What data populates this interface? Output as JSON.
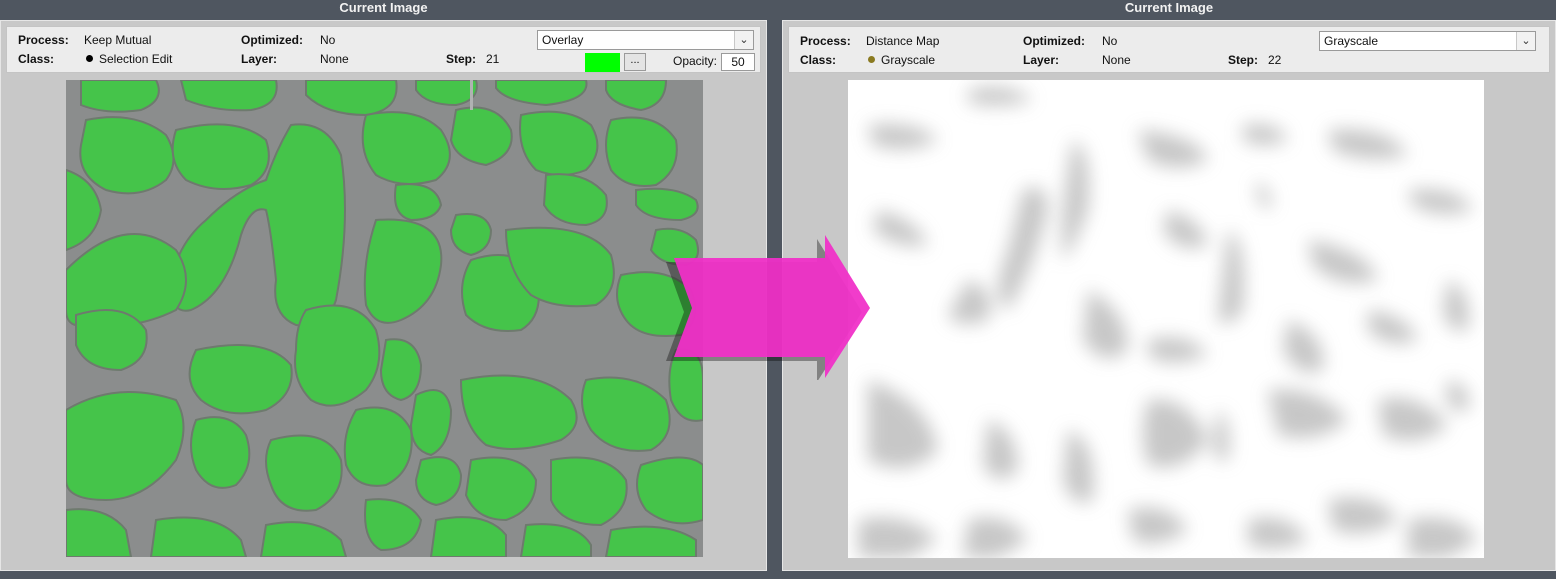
{
  "left_panel": {
    "title": "Current Image",
    "process_label": "Process:",
    "process_value": "Keep Mutual",
    "optimized_label": "Optimized:",
    "optimized_value": "No",
    "class_label": "Class:",
    "class_value": "Selection Edit",
    "class_color": "#000000",
    "layer_label": "Layer:",
    "layer_value": "None",
    "step_label": "Step:",
    "step_value": "21",
    "display_mode": "Overlay",
    "overlay_color": "#00ff00",
    "ellipsis_label": "...",
    "opacity_label": "Opacity:",
    "opacity_value": "50"
  },
  "right_panel": {
    "title": "Current Image",
    "process_label": "Process:",
    "process_value": "Distance Map",
    "optimized_label": "Optimized:",
    "optimized_value": "No",
    "class_label": "Class:",
    "class_value": "Grayscale",
    "class_color": "#8a7a20",
    "layer_label": "Layer:",
    "layer_value": "None",
    "step_label": "Step:",
    "step_value": "22",
    "display_mode": "Grayscale"
  },
  "arrow_color": "#f030c8",
  "icons": {
    "dropdown": "chevron-down-icon"
  }
}
